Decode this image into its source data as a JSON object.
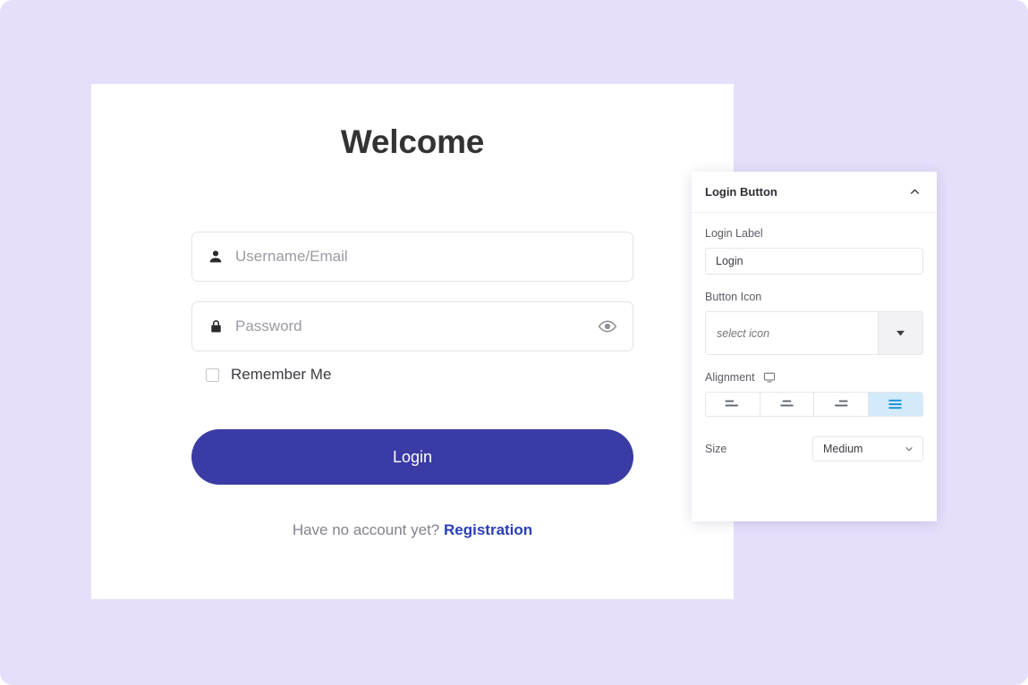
{
  "theme": {
    "background": "#e6dffb",
    "card_background": "#ffffff",
    "primary_button": "#3b3ba5",
    "link_color": "#2a3fb8",
    "active_toggle_bg": "#d3eafb",
    "active_toggle_fg": "#2196d8"
  },
  "login_card": {
    "title": "Welcome",
    "username": {
      "placeholder": "Username/Email",
      "value": "",
      "icon": "user-icon"
    },
    "password": {
      "placeholder": "Password",
      "value": "",
      "icon": "lock-icon",
      "toggle_icon": "eye-icon"
    },
    "remember_me": {
      "label": "Remember Me",
      "checked": false
    },
    "submit_label": "Login",
    "footer": {
      "prompt": "Have no account yet?",
      "link_label": "Registration"
    }
  },
  "settings_panel": {
    "title": "Login Button",
    "collapse_icon": "chevron-up-icon",
    "login_label": {
      "label": "Login Label",
      "value": "Login"
    },
    "button_icon": {
      "label": "Button Icon",
      "placeholder": "select icon",
      "value": "",
      "trigger_icon": "triangle-down-icon"
    },
    "alignment": {
      "label": "Alignment",
      "device_icon": "desktop-icon",
      "options": [
        {
          "name": "left",
          "icon": "align-left-icon",
          "active": false
        },
        {
          "name": "center",
          "icon": "align-center-icon",
          "active": false
        },
        {
          "name": "right",
          "icon": "align-right-icon",
          "active": false
        },
        {
          "name": "justify",
          "icon": "align-justify-icon",
          "active": true
        }
      ]
    },
    "size": {
      "label": "Size",
      "value": "Medium",
      "chevron_icon": "chevron-down-icon"
    }
  }
}
